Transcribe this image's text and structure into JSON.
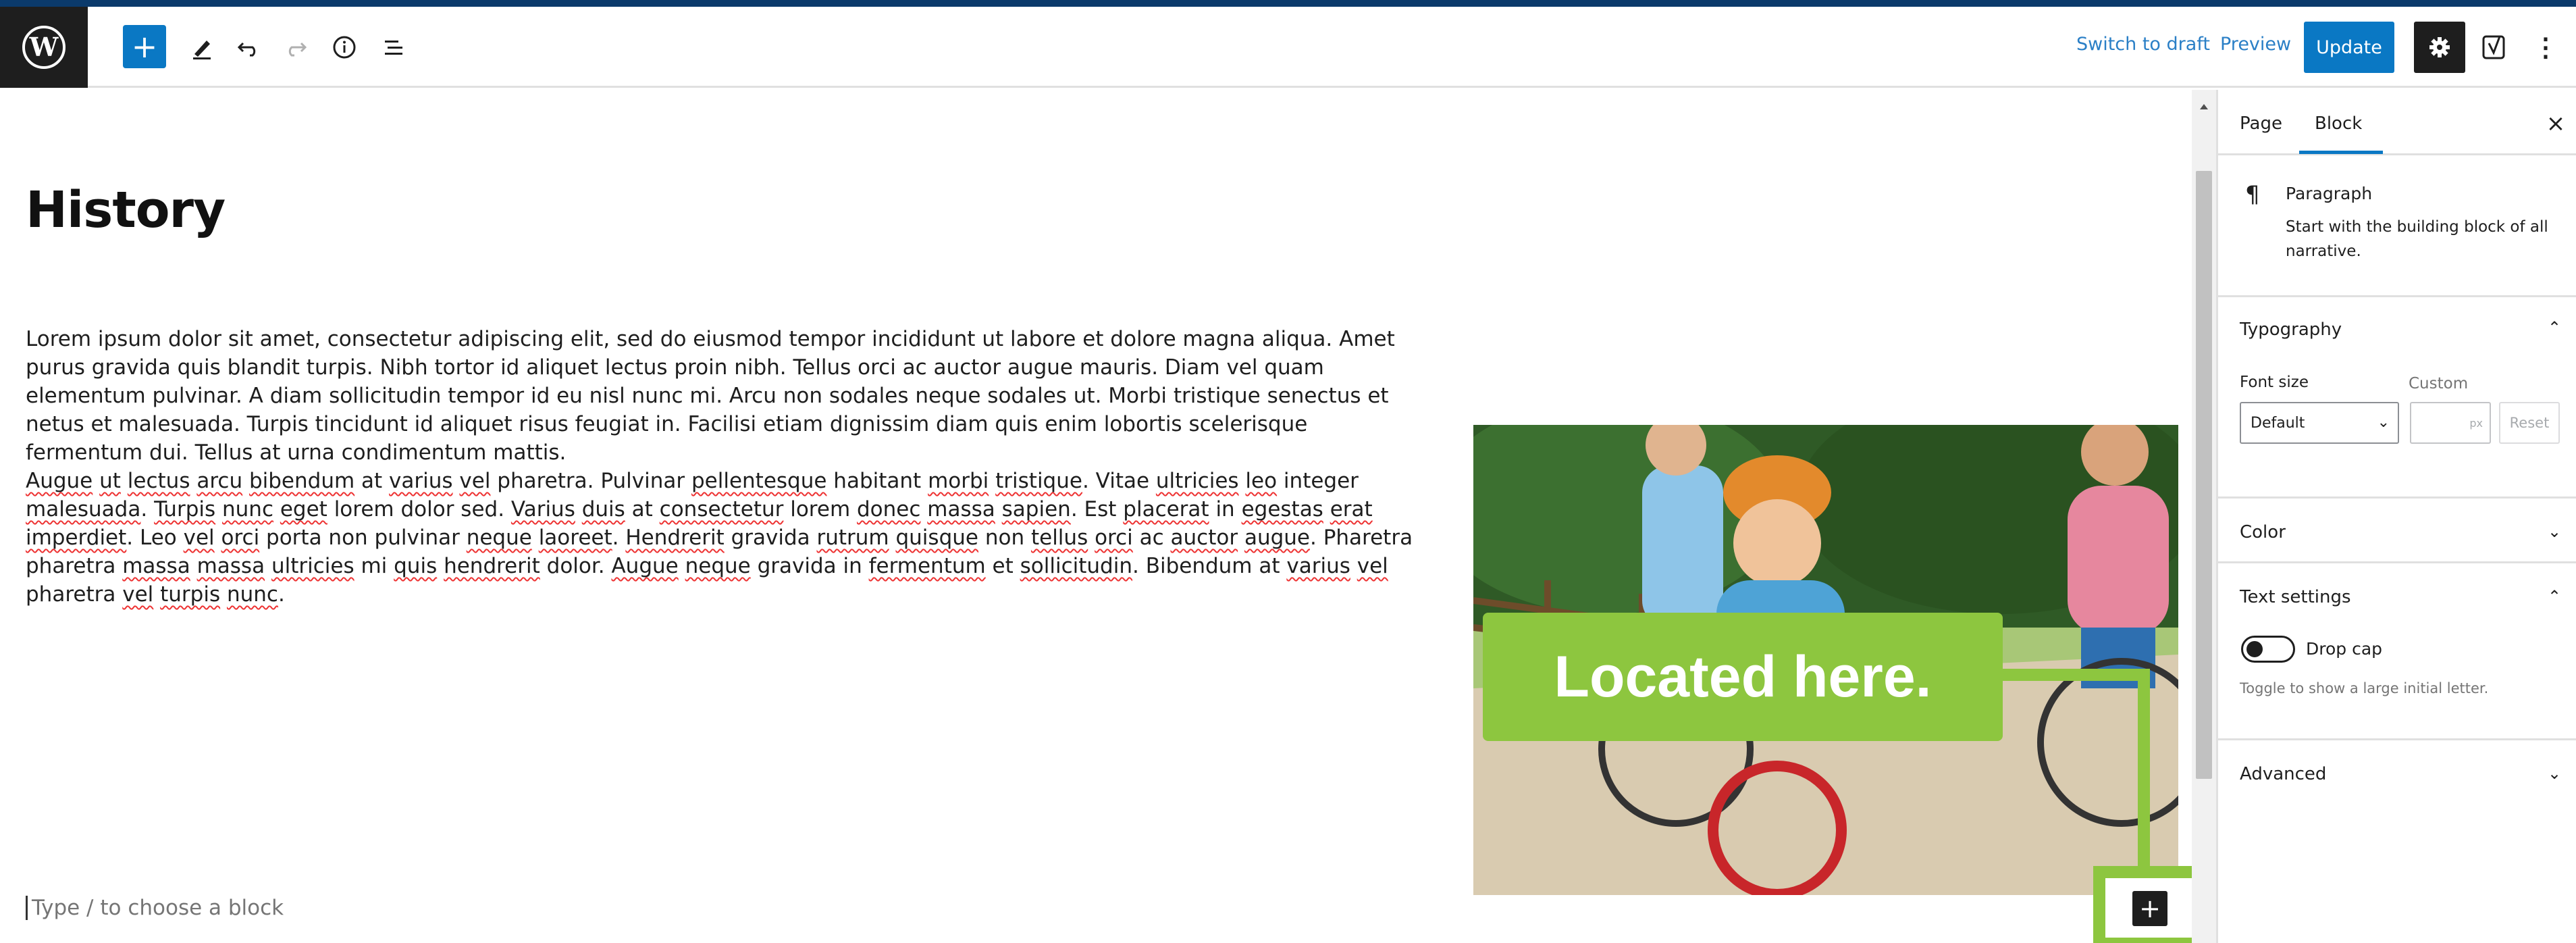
{
  "toolbar": {
    "switch_to_draft": "Switch to draft",
    "preview": "Preview",
    "update": "Update",
    "add_block_symbol": "+",
    "more_symbol": "⋮"
  },
  "editor": {
    "heading": "History",
    "paragraph1": "Lorem ipsum dolor sit amet, consectetur adipiscing elit, sed do eiusmod tempor incididunt ut labore et dolore magna aliqua. Amet purus gravida quis blandit turpis. Nibh tortor id aliquet lectus proin nibh. Tellus orci ac auctor augue mauris. Diam vel quam elementum pulvinar. A diam sollicitudin tempor id eu nisl nunc mi. Arcu non sodales neque sodales ut. Morbi tristique senectus et netus et malesuada. Turpis tincidunt id aliquet risus feugiat in. Facilisi etiam dignissim diam quis enim lobortis scelerisque fermentum dui. Tellus at urna condimentum mattis.",
    "paragraph2_words": [
      {
        "t": "Augue",
        "s": true
      },
      {
        "t": " "
      },
      {
        "t": "ut",
        "s": true
      },
      {
        "t": " "
      },
      {
        "t": "lectus",
        "s": true
      },
      {
        "t": " "
      },
      {
        "t": "arcu",
        "s": true
      },
      {
        "t": " "
      },
      {
        "t": "bibendum",
        "s": true
      },
      {
        "t": " at "
      },
      {
        "t": "varius",
        "s": true
      },
      {
        "t": " "
      },
      {
        "t": "vel",
        "s": true
      },
      {
        "t": " pharetra. Pulvinar "
      },
      {
        "t": "pellentesque",
        "s": true
      },
      {
        "t": " habitant "
      },
      {
        "t": "morbi",
        "s": true
      },
      {
        "t": " "
      },
      {
        "t": "tristique",
        "s": true
      },
      {
        "t": ". Vitae "
      },
      {
        "t": "ultricies",
        "s": true
      },
      {
        "t": " "
      },
      {
        "t": "leo",
        "s": true
      },
      {
        "t": " integer "
      },
      {
        "t": "malesuada",
        "s": true
      },
      {
        "t": ". "
      },
      {
        "t": "Turpis",
        "s": true
      },
      {
        "t": " "
      },
      {
        "t": "nunc",
        "s": true
      },
      {
        "t": " "
      },
      {
        "t": "eget",
        "s": true
      },
      {
        "t": " lorem dolor sed. "
      },
      {
        "t": "Varius",
        "s": true
      },
      {
        "t": " "
      },
      {
        "t": "duis",
        "s": true
      },
      {
        "t": " at "
      },
      {
        "t": "consectetur",
        "s": true
      },
      {
        "t": " lorem "
      },
      {
        "t": "donec",
        "s": true
      },
      {
        "t": " "
      },
      {
        "t": "massa",
        "s": true
      },
      {
        "t": " "
      },
      {
        "t": "sapien",
        "s": true
      },
      {
        "t": ". Est "
      },
      {
        "t": "placerat",
        "s": true
      },
      {
        "t": " in "
      },
      {
        "t": "egestas",
        "s": true
      },
      {
        "t": " "
      },
      {
        "t": "erat",
        "s": true
      },
      {
        "t": " "
      },
      {
        "t": "imperdiet",
        "s": true
      },
      {
        "t": ". Leo "
      },
      {
        "t": "vel",
        "s": true
      },
      {
        "t": " "
      },
      {
        "t": "orci",
        "s": true
      },
      {
        "t": " porta non pulvinar "
      },
      {
        "t": "neque",
        "s": true
      },
      {
        "t": " "
      },
      {
        "t": "laoreet",
        "s": true
      },
      {
        "t": ". "
      },
      {
        "t": "Hendrerit",
        "s": true
      },
      {
        "t": " gravida "
      },
      {
        "t": "rutrum",
        "s": true
      },
      {
        "t": " "
      },
      {
        "t": "quisque",
        "s": true
      },
      {
        "t": " non "
      },
      {
        "t": "tellus",
        "s": true
      },
      {
        "t": " "
      },
      {
        "t": "orci",
        "s": true
      },
      {
        "t": " ac "
      },
      {
        "t": "auctor",
        "s": true
      },
      {
        "t": " "
      },
      {
        "t": "augue",
        "s": true
      },
      {
        "t": ". Pharetra pharetra "
      },
      {
        "t": "massa",
        "s": true
      },
      {
        "t": " "
      },
      {
        "t": "massa",
        "s": true
      },
      {
        "t": " "
      },
      {
        "t": "ultricies",
        "s": true
      },
      {
        "t": " mi "
      },
      {
        "t": "quis",
        "s": true
      },
      {
        "t": " "
      },
      {
        "t": "hendrerit",
        "s": true
      },
      {
        "t": " dolor. "
      },
      {
        "t": "Augue",
        "s": true
      },
      {
        "t": " "
      },
      {
        "t": "neque",
        "s": true
      },
      {
        "t": " gravida in "
      },
      {
        "t": "fermentum",
        "s": true
      },
      {
        "t": " et "
      },
      {
        "t": "sollicitudin",
        "s": true
      },
      {
        "t": ". Bibendum at "
      },
      {
        "t": "varius",
        "s": true
      },
      {
        "t": " "
      },
      {
        "t": "vel",
        "s": true
      },
      {
        "t": " pharetra "
      },
      {
        "t": "vel",
        "s": true
      },
      {
        "t": " "
      },
      {
        "t": "turpis",
        "s": true
      },
      {
        "t": " "
      },
      {
        "t": "nunc",
        "s": true
      },
      {
        "t": "."
      }
    ],
    "block_placeholder": "Type / to choose a block",
    "image_icon": "family-cycling-photo",
    "callout_text": "Located here.",
    "inline_add_symbol": "+"
  },
  "sidebar": {
    "tabs": [
      "Page",
      "Block"
    ],
    "active_tab": "Block",
    "close_symbol": "×",
    "block_icon": "¶",
    "block_title": "Paragraph",
    "block_description": "Start with the building block of all narrative.",
    "typography": {
      "title": "Typography",
      "font_size_label": "Font size",
      "custom_label": "Custom",
      "font_size_value": "Default",
      "custom_unit": "px",
      "reset": "Reset"
    },
    "color_title": "Color",
    "text_settings": {
      "title": "Text settings",
      "drop_cap_label": "Drop cap",
      "drop_cap_help": "Toggle to show a large initial letter."
    },
    "advanced_title": "Advanced",
    "chevron_up": "⌃",
    "chevron_down": "⌄"
  },
  "colors": {
    "accent": "#0a78c4",
    "callout": "#8dc63f",
    "frame": "#0b3a6b"
  }
}
